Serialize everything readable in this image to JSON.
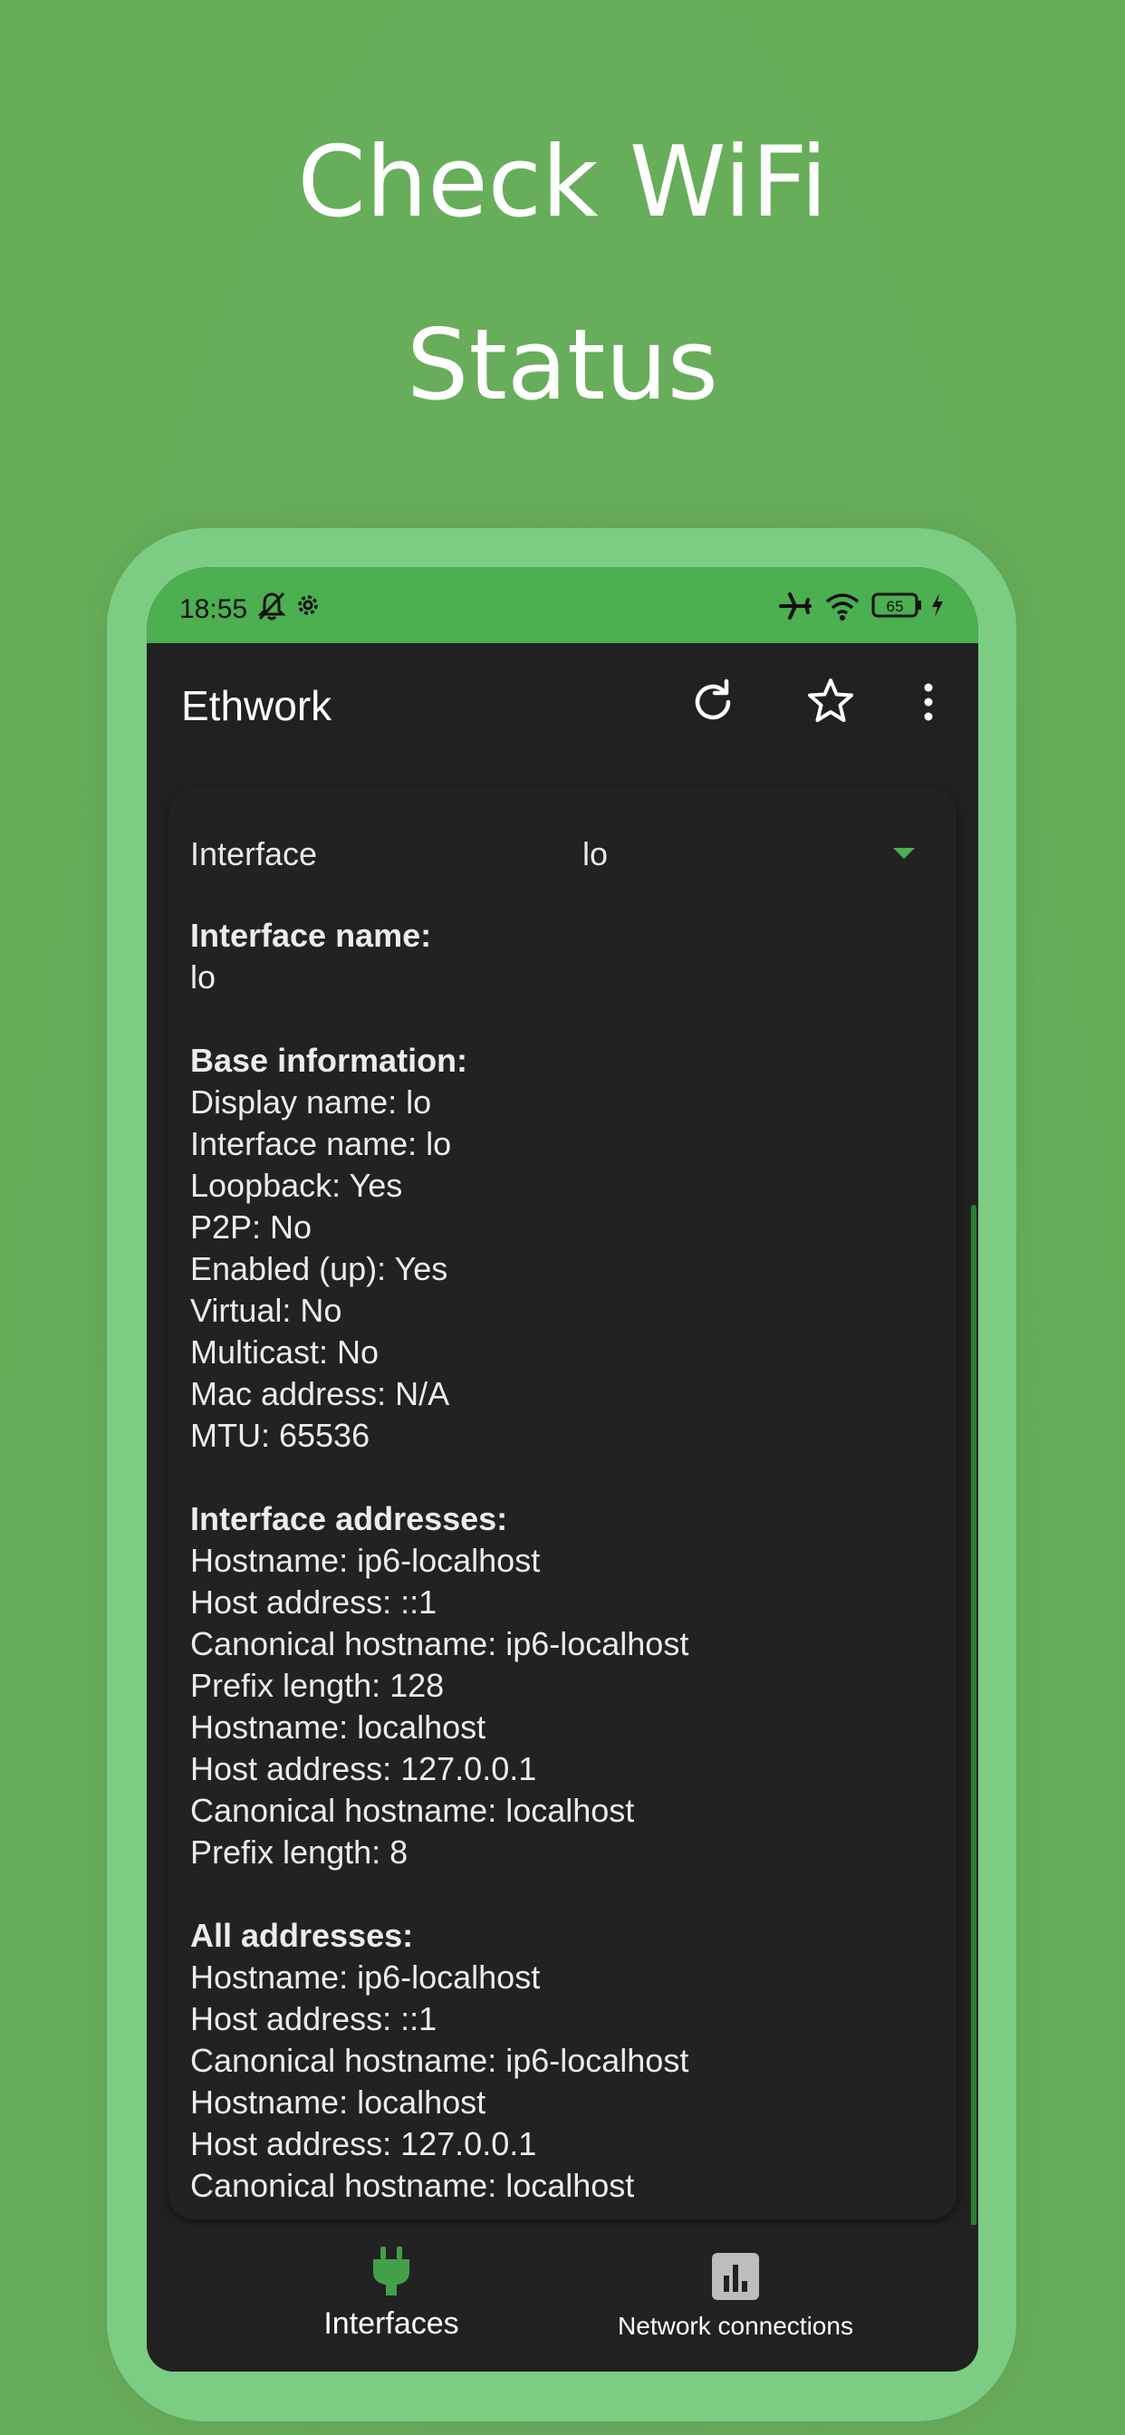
{
  "promo": {
    "line1": "Check WiFi",
    "line2": "Status"
  },
  "status_bar": {
    "time": "18:55",
    "battery": "65"
  },
  "app_bar": {
    "title": "Ethwork",
    "icons": [
      "refresh-icon",
      "star-icon",
      "more-vert-icon"
    ]
  },
  "interface_selector": {
    "label": "Interface",
    "value": "lo"
  },
  "details": {
    "interface_name_heading": "Interface name:",
    "interface_name_value": "lo",
    "base_heading": "Base information:",
    "base_lines": [
      "Display name: lo",
      "Interface name: lo",
      "Loopback: Yes",
      "P2P: No",
      "Enabled (up): Yes",
      "Virtual: No",
      "Multicast: No",
      "Mac address: N/A",
      "MTU: 65536"
    ],
    "iface_addr_heading": "Interface addresses:",
    "iface_addr_lines": [
      "Hostname: ip6-localhost",
      "Host address: ::1",
      "Canonical hostname: ip6-localhost",
      "Prefix length: 128",
      "Hostname: localhost",
      "Host address: 127.0.0.1",
      "Canonical hostname: localhost",
      "Prefix length: 8"
    ],
    "all_addr_heading": "All addresses:",
    "all_addr_lines": [
      "Hostname: ip6-localhost",
      "Host address: ::1",
      "Canonical hostname: ip6-localhost",
      "Hostname: localhost",
      "Host address: 127.0.0.1",
      "Canonical hostname: localhost"
    ]
  },
  "bottom_nav": {
    "items": [
      {
        "label": "Interfaces",
        "icon": "plug-icon",
        "active": true
      },
      {
        "label": "Network connections",
        "icon": "bar-chart-icon",
        "active": false
      }
    ]
  },
  "colors": {
    "background": "#66ae57",
    "frame": "#7dcc84",
    "accent": "#4caf50",
    "surface": "#212121"
  }
}
